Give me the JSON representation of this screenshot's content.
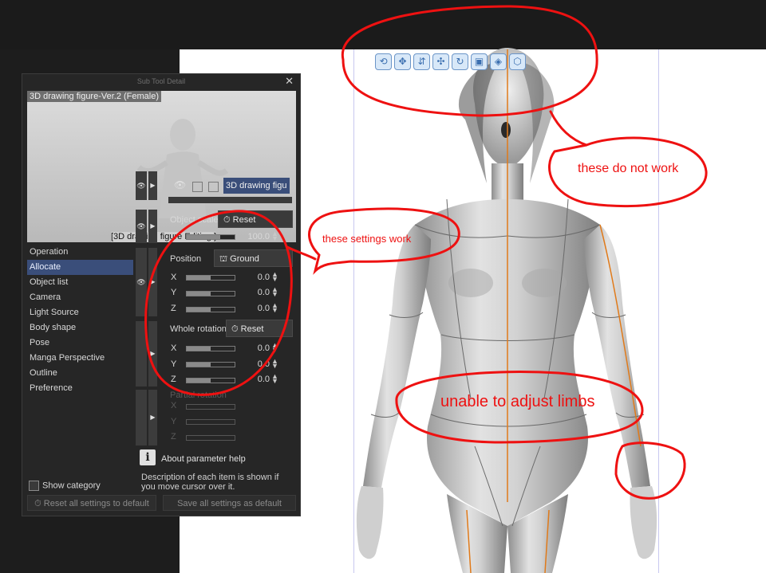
{
  "panel": {
    "title": "Sub Tool Detail",
    "close_icon": "close-icon",
    "preview_name": "3D drawing figure-Ver.2 (Female)",
    "preview_caption": "[3D drawing figure Editing ]",
    "categories": [
      {
        "label": "Operation"
      },
      {
        "label": "Allocate",
        "selected": true
      },
      {
        "label": "Object list"
      },
      {
        "label": "Camera"
      },
      {
        "label": "Light Source"
      },
      {
        "label": "Body shape"
      },
      {
        "label": "Pose"
      },
      {
        "label": "Manga Perspective"
      },
      {
        "label": "Outline"
      },
      {
        "label": "Preference"
      }
    ],
    "show_category": "Show category",
    "reset_all": "Reset all settings to default",
    "save_all": "Save all settings as default",
    "object_list_item": "3D drawing figu",
    "object_scale": {
      "label": "Object scale",
      "button": "Reset",
      "value": "100.0"
    },
    "position": {
      "label": "Position",
      "button": "Ground",
      "x": "0.0",
      "y": "0.0",
      "z": "0.0"
    },
    "whole_rotation": {
      "label": "Whole rotation",
      "button": "Reset",
      "x": "0.0",
      "y": "0.0",
      "z": "0.0"
    },
    "partial_rotation": {
      "label": "Partial rotation"
    },
    "axis_x": "X",
    "axis_y": "Y",
    "axis_z": "Z",
    "help_title": "About parameter help",
    "help_desc": "Description of each item is shown if you move cursor over it."
  },
  "manipulator_icons": [
    "rotate-camera-icon",
    "move-camera-icon",
    "pan-camera-icon",
    "move-object-icon",
    "rotate-object-icon",
    "object-view-icon",
    "reset-view-icon",
    "fit-view-icon"
  ],
  "annotations": {
    "top_callout": "these do not work",
    "settings_callout": "these settings work",
    "limbs_callout": "unable to adjust limbs"
  },
  "colors": {
    "annotation": "#ee1111",
    "selection": "#3a4e7a",
    "figure_line": "#e07a1a"
  }
}
